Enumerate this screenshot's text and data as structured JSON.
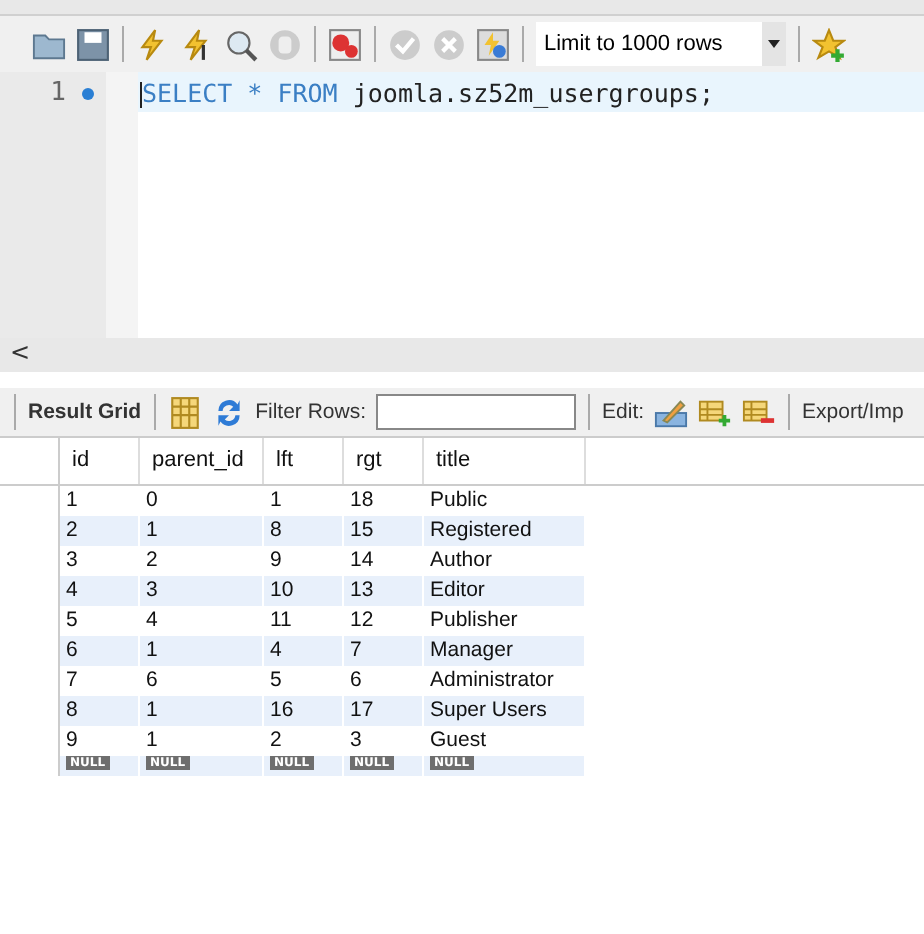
{
  "toolbar": {
    "limit": "Limit to 1000 rows"
  },
  "editor": {
    "line_number": "1",
    "keywords": "SELECT * FROM",
    "query": "joomla.sz52m_usergroups;"
  },
  "scrollbar": {
    "arrow": "<"
  },
  "result_toolbar": {
    "result_grid": "Result Grid",
    "filter_label": "Filter Rows:",
    "edit_label": "Edit:",
    "export_label": "Export/Imp"
  },
  "table": {
    "columns": [
      "id",
      "parent_id",
      "lft",
      "rgt",
      "title"
    ],
    "rows": [
      [
        "1",
        "0",
        "1",
        "18",
        "Public"
      ],
      [
        "2",
        "1",
        "8",
        "15",
        "Registered"
      ],
      [
        "3",
        "2",
        "9",
        "14",
        "Author"
      ],
      [
        "4",
        "3",
        "10",
        "13",
        "Editor"
      ],
      [
        "5",
        "4",
        "11",
        "12",
        "Publisher"
      ],
      [
        "6",
        "1",
        "4",
        "7",
        "Manager"
      ],
      [
        "7",
        "6",
        "5",
        "6",
        "Administrator"
      ],
      [
        "8",
        "1",
        "16",
        "17",
        "Super Users"
      ],
      [
        "9",
        "1",
        "2",
        "3",
        "Guest"
      ]
    ],
    "null_row": [
      "NULL",
      "NULL",
      "NULL",
      "NULL",
      "NULL"
    ]
  }
}
